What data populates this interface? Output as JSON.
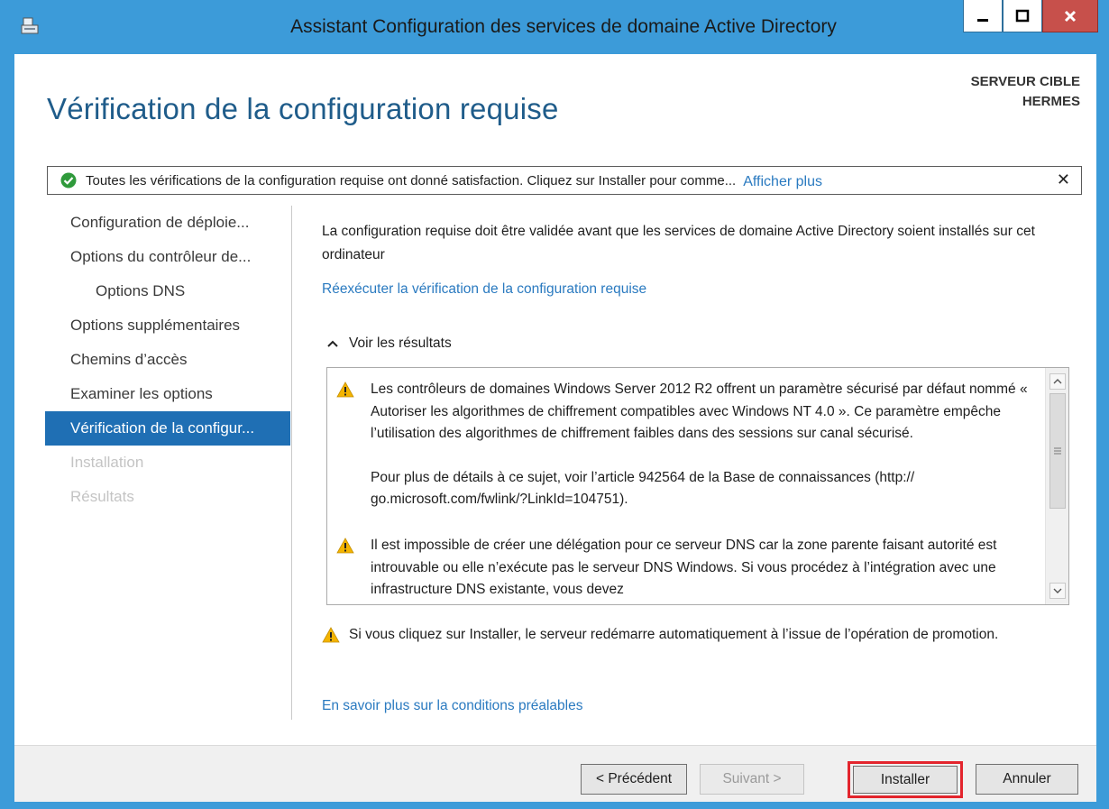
{
  "window": {
    "title": "Assistant Configuration des services de domaine Active Directory",
    "controls": {
      "minimize": "minimize",
      "maximize": "maximize",
      "close": "close"
    }
  },
  "header": {
    "page_title": "Vérification de la configuration requise",
    "target_label_line1": "SERVEUR CIBLE",
    "target_label_line2": "HERMES"
  },
  "banner": {
    "text": "Toutes les vérifications de la configuration requise ont donné satisfaction. Cliquez sur Installer pour comme...",
    "link": "Afficher plus",
    "close": "✕"
  },
  "nav": {
    "items": [
      {
        "label": "Configuration de déploie...",
        "state": "normal"
      },
      {
        "label": "Options du contrôleur de...",
        "state": "normal"
      },
      {
        "label": "Options DNS",
        "state": "sub"
      },
      {
        "label": "Options supplémentaires",
        "state": "normal"
      },
      {
        "label": "Chemins d’accès",
        "state": "normal"
      },
      {
        "label": "Examiner les options",
        "state": "normal"
      },
      {
        "label": "Vérification de la configur...",
        "state": "active"
      },
      {
        "label": "Installation",
        "state": "disabled"
      },
      {
        "label": "Résultats",
        "state": "disabled"
      }
    ]
  },
  "main": {
    "intro": "La configuration requise doit être validée avant que les services de domaine Active Directory soient installés sur cet ordinateur",
    "rerun_link": "Réexécuter la vérification de la configuration requise",
    "results_toggle": "Voir les résultats",
    "results": [
      {
        "icon": "warning-icon",
        "paragraph1": "Les contrôleurs de domaines Windows Server 2012 R2 offrent un paramètre sécurisé par défaut nommé « Autoriser les algorithmes de chiffrement compatibles avec Windows NT 4.0 ». Ce paramètre empêche l’utilisation des algorithmes de chiffrement faibles dans des sessions sur canal sécurisé.",
        "paragraph2": "Pour plus de détails à ce sujet, voir l’article 942564 de la Base de connaissances (http:// go.microsoft.com/fwlink/?LinkId=104751)."
      },
      {
        "icon": "warning-icon",
        "paragraph1": "Il est impossible de créer une délégation pour ce serveur DNS car la zone parente faisant autorité est introuvable ou elle n’exécute pas le serveur DNS Windows. Si vous procédez à l’intégration avec une infrastructure DNS existante, vous devez"
      }
    ],
    "restart_warning": "Si vous cliquez sur Installer, le serveur redémarre automatiquement à l’issue de l’opération de promotion.",
    "learn_more_link": "En savoir plus sur la conditions préalables"
  },
  "footer": {
    "prev": "< Précédent",
    "next": "Suivant >",
    "install": "Installer",
    "cancel": "Annuler"
  },
  "colors": {
    "frame": "#3c9bd9",
    "title_blue": "#1f5c8a",
    "link": "#2a7ac0",
    "nav_active": "#1f6fb4",
    "highlight": "#e3252d",
    "close_button": "#c7504b"
  }
}
